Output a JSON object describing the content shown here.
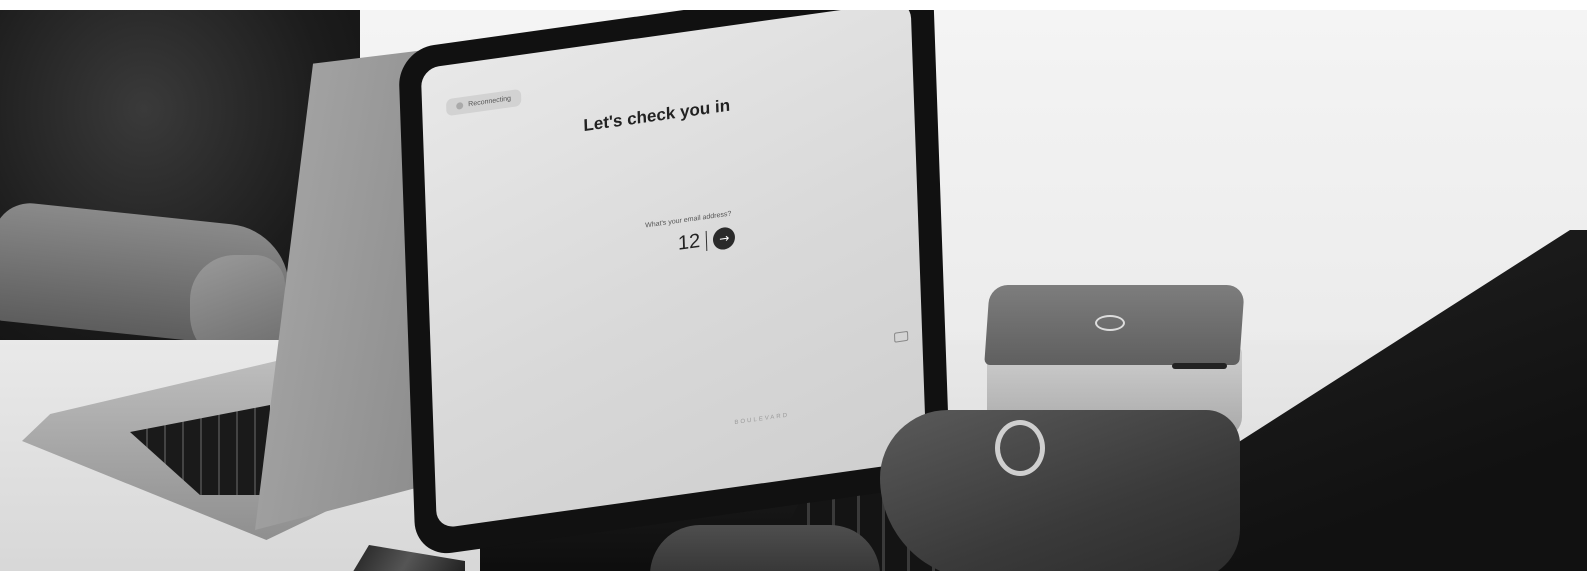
{
  "tablet": {
    "status_label": "Reconnecting",
    "title": "Let's check you in",
    "email_prompt": "What's your email address?",
    "email_value": "12",
    "submit_icon": "arrow-right-icon",
    "brand": "BOULEVARD"
  }
}
